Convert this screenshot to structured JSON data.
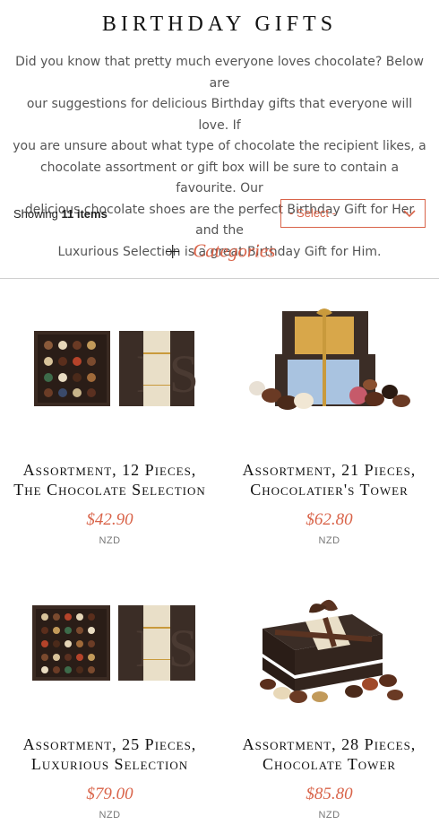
{
  "page": {
    "title": "BIRTHDAY GIFTS",
    "intro_lines": [
      "Did you know that pretty much everyone loves chocolate? Below are",
      "our suggestions for delicious Birthday gifts that everyone will love. If",
      "you are unsure about what type of chocolate the recipient likes, a",
      "chocolate assortment or gift box will be sure to contain a favourite. Our",
      "delicious chocolate shoes are the perfect Birthday Gift for Her and the",
      "Luxurious Selection is a great Birthday Gift for Him."
    ]
  },
  "toolbar": {
    "showing_prefix": "Showing",
    "item_count": "11 items",
    "select_value": "- Select -",
    "categories_label": "Categories"
  },
  "products": [
    {
      "name_line1": "Assortment, 12 Pieces,",
      "name_line2": "The Chocolate Selection",
      "price": "$42.90",
      "currency": "NZD"
    },
    {
      "name_line1": "Assortment, 21 Pieces,",
      "name_line2": "Chocolatier's Tower",
      "price": "$62.80",
      "currency": "NZD"
    },
    {
      "name_line1": "Assortment, 25 Pieces,",
      "name_line2": "Luxurious Selection",
      "price": "$79.00",
      "currency": "NZD"
    },
    {
      "name_line1": "Assortment, 28 Pieces,",
      "name_line2": "Chocolate Tower",
      "price": "$85.80",
      "currency": "NZD"
    }
  ],
  "colors": {
    "accent": "#d9644a",
    "box_dark": "#3b2d26",
    "gold": "#c99a3c",
    "ribbon": "#5a3321"
  }
}
